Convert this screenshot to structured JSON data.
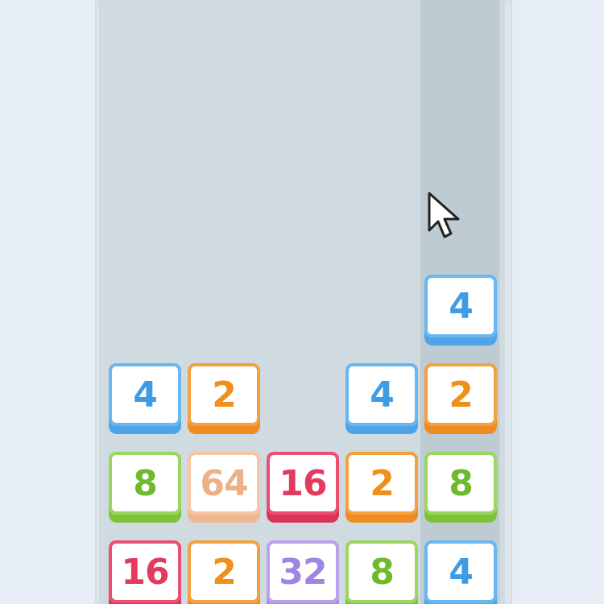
{
  "game": {
    "highlighted_column": 5,
    "tiles": [
      {
        "row": 0,
        "col": 5,
        "value": "4",
        "kind": "four"
      },
      {
        "row": 1,
        "col": 1,
        "value": "4",
        "kind": "four"
      },
      {
        "row": 1,
        "col": 2,
        "value": "2",
        "kind": "two"
      },
      {
        "row": 1,
        "col": 4,
        "value": "4",
        "kind": "four"
      },
      {
        "row": 1,
        "col": 5,
        "value": "2",
        "kind": "two"
      },
      {
        "row": 2,
        "col": 1,
        "value": "8",
        "kind": "eight"
      },
      {
        "row": 2,
        "col": 2,
        "value": "64",
        "kind": "sixtyfour"
      },
      {
        "row": 2,
        "col": 3,
        "value": "16",
        "kind": "sixteen"
      },
      {
        "row": 2,
        "col": 4,
        "value": "2",
        "kind": "two"
      },
      {
        "row": 2,
        "col": 5,
        "value": "8",
        "kind": "eight"
      },
      {
        "row": 3,
        "col": 1,
        "value": "16",
        "kind": "sixteen"
      },
      {
        "row": 3,
        "col": 2,
        "value": "2",
        "kind": "two"
      },
      {
        "row": 3,
        "col": 3,
        "value": "32",
        "kind": "thirtytwo"
      },
      {
        "row": 3,
        "col": 4,
        "value": "8",
        "kind": "eight"
      },
      {
        "row": 3,
        "col": 5,
        "value": "4",
        "kind": "four"
      }
    ]
  },
  "colors": {
    "two": "#f08f1c",
    "four": "#3d9ce4",
    "eight": "#6dbb2c",
    "sixteen": "#e43a5e",
    "thirtytwo": "#9f86e0",
    "sixtyfour": "#edb185",
    "board": "#d0dae1",
    "highlight": "#bfcbd3"
  },
  "cursor": {
    "icon": "mouse-pointer-icon"
  }
}
